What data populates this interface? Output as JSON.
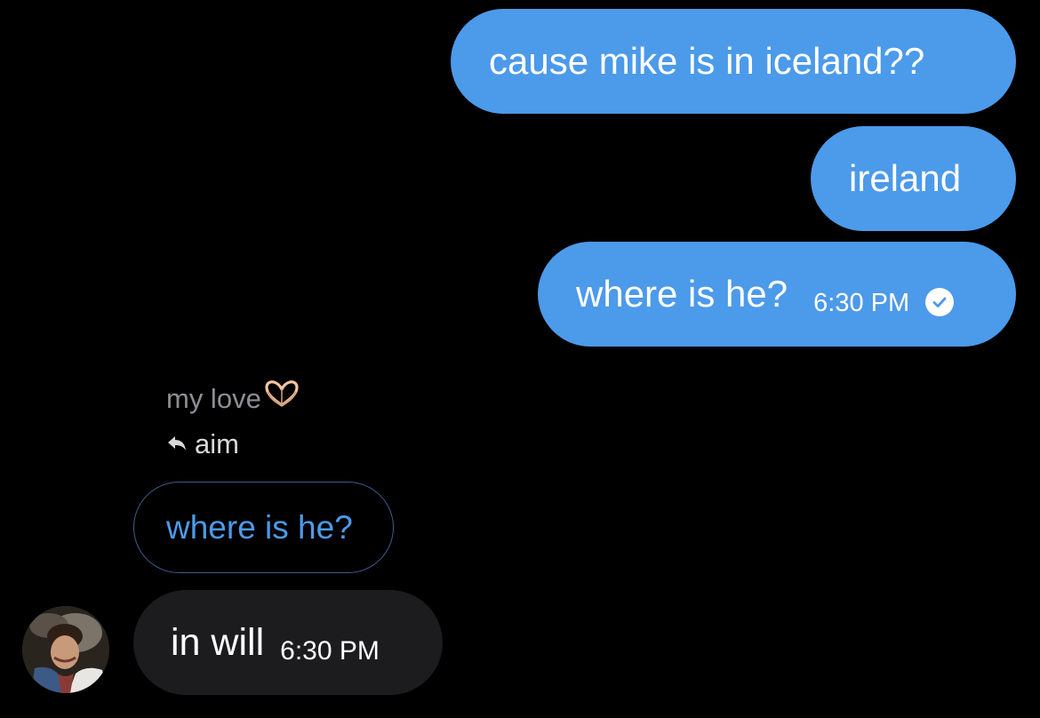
{
  "colors": {
    "background": "#000000",
    "outgoing_bubble": "#4c9aea",
    "incoming_bubble": "#1c1c1e",
    "quoted_border": "#3a5f8f",
    "quoted_text": "#4c9aea",
    "sender_name": "#8e8e93"
  },
  "outgoing": [
    {
      "text": "cause mike is in iceland??"
    },
    {
      "text": "ireland"
    },
    {
      "text": "where is he?",
      "time": "6:30 PM",
      "status_icon": "read-check-icon"
    }
  ],
  "incoming_group": {
    "sender_name": "my love",
    "sender_emoji": "heart-hands-icon",
    "reply_icon": "reply-arrow-icon",
    "reply_to": "aim",
    "quoted_text": "where is he?",
    "message": {
      "text": "in will",
      "time": "6:30 PM"
    },
    "avatar": "avatar"
  }
}
